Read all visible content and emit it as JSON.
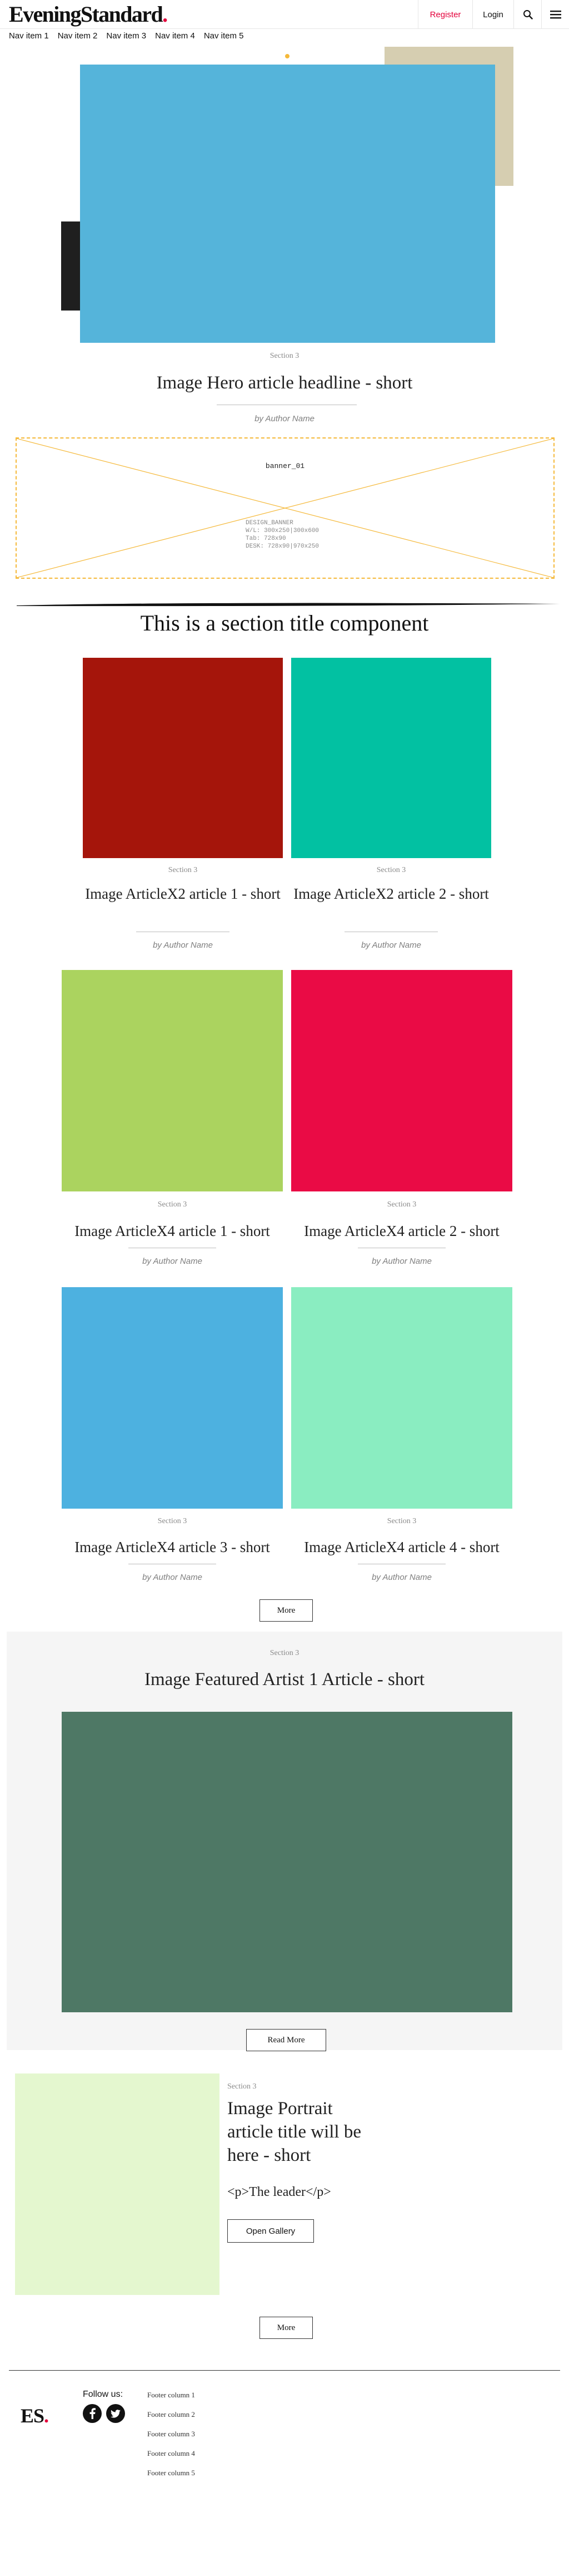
{
  "header": {
    "logo_text": "EveningStandard",
    "logo_dot": ".",
    "register": "Register",
    "login": "Login",
    "search_icon": "search-icon",
    "menu_icon": "hamburger-menu-icon",
    "brand_color": "#e4003b"
  },
  "nav": [
    "Nav item 1",
    "Nav item 2",
    "Nav item 3",
    "Nav item 4",
    "Nav item 5"
  ],
  "hero": {
    "kicker": "Section 3",
    "headline": "Image Hero article headline - short",
    "byline": "by Author Name",
    "image_color": "#55b4da"
  },
  "banner": {
    "label": "banner_01",
    "info": "DESIGN_BANNER\nW/L: 300x250|300x600\nTab: 728x90\nDESK: 728x90|970x250"
  },
  "section_title": "This is a section title component",
  "x2": [
    {
      "kicker": "Section 3",
      "title": "Image ArticleX2 article 1 - short",
      "byline": "by Author Name",
      "color": "#a5150b"
    },
    {
      "kicker": "Section 3",
      "title": "Image ArticleX2 article 2 - short",
      "byline": "by Author Name",
      "color": "#02c1a2"
    }
  ],
  "x4": [
    {
      "kicker": "Section 3",
      "title": "Image ArticleX4 article 1 - short",
      "byline": "by Author Name",
      "color": "#abd35f"
    },
    {
      "kicker": "Section 3",
      "title": "Image ArticleX4 article 2 - short",
      "byline": "by Author Name",
      "color": "#ea0b45"
    },
    {
      "kicker": "Section 3",
      "title": "Image ArticleX4 article 3 - short",
      "byline": "by Author Name",
      "color": "#4db1e0"
    },
    {
      "kicker": "Section 3",
      "title": "Image ArticleX4 article 4 - short",
      "byline": "by Author Name",
      "color": "#8aedc1"
    }
  ],
  "more_label": "More",
  "featured": {
    "kicker": "Section 3",
    "headline": "Image Featured Artist 1 Article - short",
    "image_color": "#4e7865",
    "read_more": "Read More"
  },
  "portrait": {
    "kicker": "Section 3",
    "title": "Image Portrait article title will be here - short",
    "leader": "<p>The leader</p>",
    "button": "Open Gallery",
    "image_color": "#e4f7cf"
  },
  "more_label_2": "More",
  "footer": {
    "logo": "ES",
    "logo_dot": ".",
    "follow": "Follow us:",
    "social": [
      "facebook-icon",
      "twitter-icon"
    ],
    "columns": [
      "Footer column 1",
      "Footer column 2",
      "Footer column 3",
      "Footer column 4",
      "Footer column 5"
    ]
  }
}
